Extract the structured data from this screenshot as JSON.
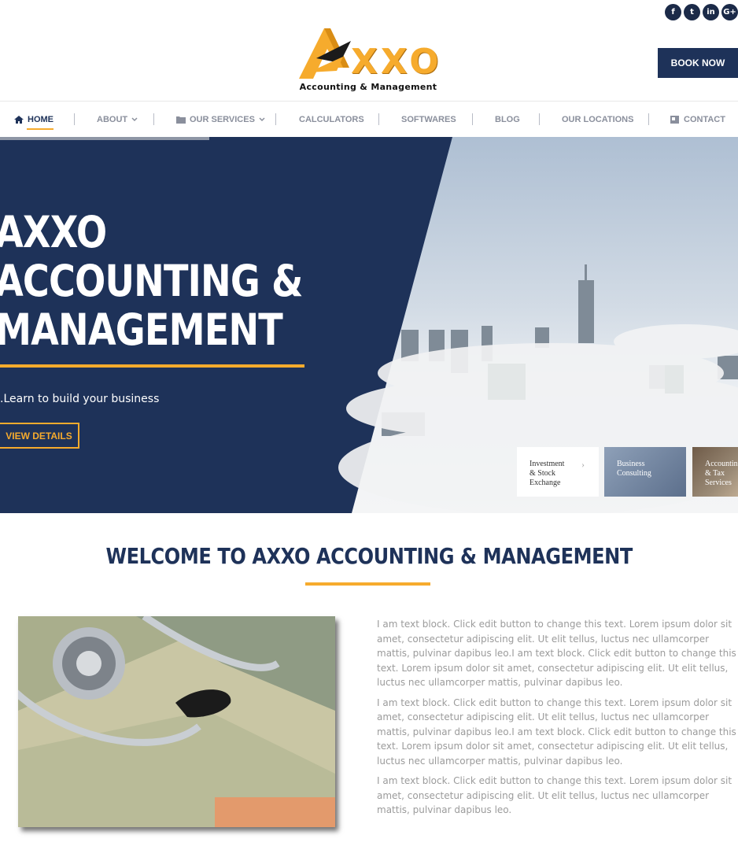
{
  "social": [
    {
      "icon": "facebook-icon",
      "glyph": "f"
    },
    {
      "icon": "twitter-icon",
      "glyph": "t"
    },
    {
      "icon": "linkedin-icon",
      "glyph": "in"
    },
    {
      "icon": "google-plus-icon",
      "glyph": "G+"
    }
  ],
  "brand": {
    "logo_text": "XXO",
    "logo_sub": "Accounting & Management"
  },
  "header": {
    "book_label": "BOOK NOW"
  },
  "nav": {
    "home": "HOME",
    "about": "ABOUT",
    "services": "OUR SERVICES",
    "calculators": "CALCULATORS",
    "softwares": "SOFTWARES",
    "blog": "BLOG",
    "locations": "OUR LOCATIONS",
    "contact": "CONTACT"
  },
  "hero": {
    "title_line1": "AXXO",
    "title_line2": "ACCOUNTING &",
    "title_line3": "MANAGEMENT",
    "subtitle": ".Learn to build your business",
    "button_label": "VIEW DETAILS",
    "cards": [
      {
        "line1": "Investment",
        "line2": "& Stock",
        "line3": "Exchange"
      },
      {
        "line1": "Business",
        "line2": "Consulting"
      },
      {
        "line1": "Accounting",
        "line2": "& Tax",
        "line3": "Services"
      }
    ]
  },
  "welcome": {
    "title": "WELCOME TO AXXO ACCOUNTING & MANAGEMENT",
    "paragraphs": [
      "I am text block. Click edit button to change this text. Lorem ipsum dolor sit amet, consectetur adipiscing elit. Ut elit tellus, luctus nec ullamcorper mattis, pulvinar dapibus leo.I am text block. Click edit button to change this text. Lorem ipsum dolor sit amet, consectetur adipiscing elit. Ut elit tellus, luctus nec ullamcorper mattis, pulvinar dapibus leo.",
      "I am text block. Click edit button to change this text. Lorem ipsum dolor sit amet, consectetur adipiscing elit. Ut elit tellus, luctus nec ullamcorper mattis, pulvinar dapibus leo.I am text block. Click edit button to change this text. Lorem ipsum dolor sit amet, consectetur adipiscing elit. Ut elit tellus, luctus nec ullamcorper mattis, pulvinar dapibus leo.",
      "I am text block. Click edit button to change this text. Lorem ipsum dolor sit amet, consectetur adipiscing elit. Ut elit tellus, luctus nec ullamcorper mattis, pulvinar dapibus leo."
    ]
  },
  "colors": {
    "navy": "#1e3259",
    "gold": "#f6ab2d",
    "text_gray": "#9b9b9b"
  }
}
